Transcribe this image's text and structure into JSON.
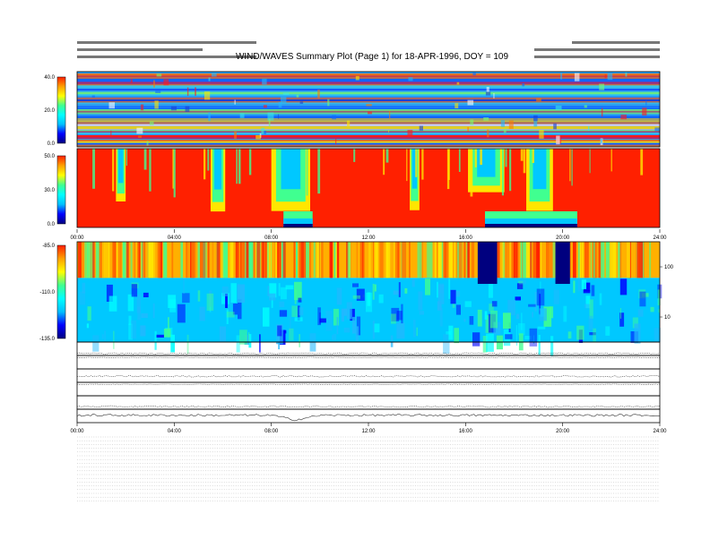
{
  "header": {
    "title": "WIND/WAVES Summary Plot (Page 1) for 18-APR-1996, DOY = 109",
    "left_lines": [
      "",
      "",
      ""
    ],
    "right_lines": [
      "",
      "",
      ""
    ],
    "right_corner_label": "",
    "rad2_units_label": "",
    "tnr_units_label": ""
  },
  "time_axis": {
    "range_hours": [
      0,
      24
    ],
    "main_ticks": [
      "00:00",
      "04:00",
      "08:00",
      "12:00",
      "16:00",
      "20:00",
      "24:00"
    ]
  },
  "colors": {
    "spectrogram_scale": [
      "#00007f",
      "#0000ff",
      "#00c0ff",
      "#00ffff",
      "#40ff90",
      "#ffff00",
      "#ffa000",
      "#ff2000"
    ],
    "rad2_band_palette": [
      "#1a3fd0",
      "#0f6bff",
      "#22b8ff",
      "#38e6e6",
      "#73ff73",
      "#ffe600",
      "#ff7a00",
      "#ff1a1a",
      "#ffffff"
    ],
    "saturated": "#ff2000",
    "trace": "#333333"
  },
  "chart_data": [
    {
      "type": "heatmap",
      "name": "",
      "x_range_hours": [
        0,
        24
      ],
      "color_scale_ticks": [
        "40.0",
        "20.0",
        "0.0"
      ],
      "colorbar_range": [
        0,
        40
      ],
      "axis_label": "",
      "right_ticks": []
    },
    {
      "type": "heatmap",
      "name": "",
      "x_range_hours": [
        0,
        24
      ],
      "color_scale_ticks": [
        "50.0",
        "30.0",
        "0.0"
      ],
      "colorbar_range": [
        0,
        50
      ],
      "axis_label": "",
      "right_ticks": [],
      "quiet_intervals_hours": [
        [
          1.6,
          2.0
        ],
        [
          5.5,
          6.1
        ],
        [
          8.0,
          9.6
        ],
        [
          13.7,
          14.1
        ],
        [
          16.1,
          17.6
        ],
        [
          18.5,
          19.6
        ]
      ],
      "low_frequency_emission_hours": [
        [
          8.5,
          9.7
        ],
        [
          16.8,
          20.6
        ]
      ]
    },
    {
      "type": "heatmap",
      "name": "",
      "x_range_hours": [
        0,
        24
      ],
      "color_scale_ticks": [
        "-85.0",
        "-110.0",
        "-135.0"
      ],
      "colorbar_range": [
        -135,
        -85
      ],
      "axis_label": "",
      "right_ticks": [
        "100",
        "10"
      ],
      "saturated_intervals_hours": [
        [
          16.5,
          17.3
        ],
        [
          19.7,
          20.3
        ]
      ]
    },
    {
      "type": "line",
      "name": "",
      "x_range_hours": [
        0,
        24
      ],
      "right_ticks": [],
      "baseline": 0.15,
      "noise": 0.05
    },
    {
      "type": "line",
      "name": "",
      "x_range_hours": [
        0,
        24
      ],
      "right_ticks": [],
      "baseline": 0.85,
      "noise": 0.02
    },
    {
      "type": "line",
      "name": "",
      "x_range_hours": [
        0,
        24
      ],
      "right_ticks": [],
      "baseline": 0.45,
      "noise": 0.06
    },
    {
      "type": "line",
      "name": "",
      "x_range_hours": [
        0,
        24
      ],
      "right_ticks": [],
      "baseline": 0.85,
      "noise": 0.02
    },
    {
      "type": "line",
      "name": "",
      "x_range_hours": [
        0,
        24
      ],
      "right_ticks": [],
      "baseline": 0.2,
      "noise": 0.06
    },
    {
      "type": "line",
      "name": "",
      "x_range_hours": [
        0,
        24
      ],
      "right_ticks": [],
      "baseline": 0.55,
      "noise": 0.08,
      "dip_hours": [
        8.0,
        10.0
      ],
      "dip_depth": 0.35
    }
  ],
  "mode_table": {
    "rows": [
      "",
      "",
      "",
      "",
      "",
      "",
      "",
      "",
      "",
      "",
      "",
      "",
      "",
      "",
      "",
      "",
      "",
      ""
    ]
  }
}
